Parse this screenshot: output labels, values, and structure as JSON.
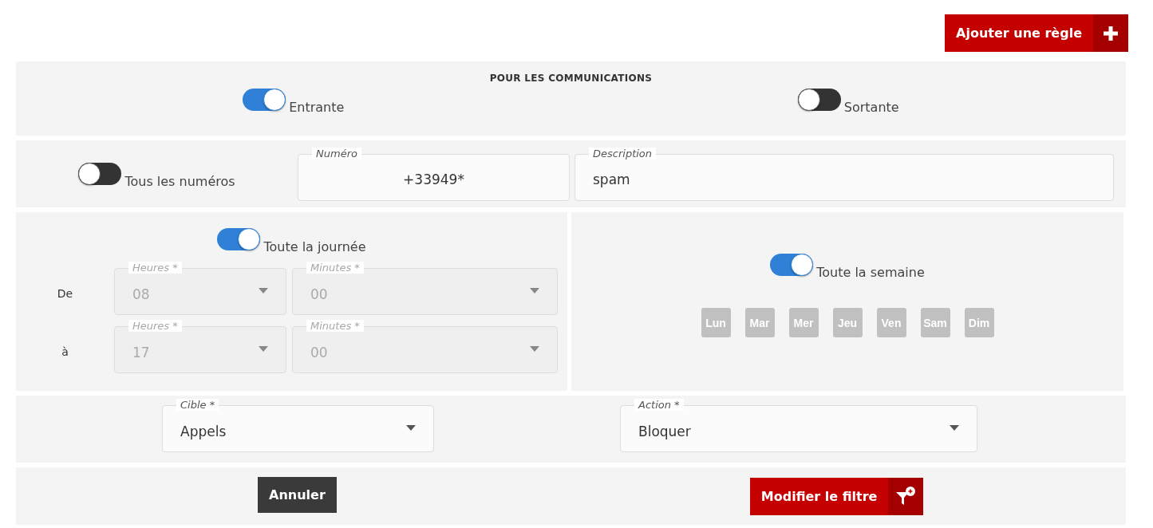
{
  "add_rule_button": {
    "label": "Ajouter une règle"
  },
  "communications": {
    "title": "POUR LES COMMUNICATIONS",
    "toggles": [
      {
        "label": "Entrante",
        "on": true
      },
      {
        "label": "Sortante",
        "on": false
      }
    ]
  },
  "numbers": {
    "all_numbers": {
      "label": "Tous les numéros",
      "on": false
    },
    "number_field": {
      "label": "Numéro",
      "value": "+33949*"
    },
    "description_field": {
      "label": "Description",
      "value": "spam"
    }
  },
  "schedule": {
    "all_day": {
      "label": "Toute la journée",
      "on": true
    },
    "rows": [
      {
        "label": "De",
        "hours": {
          "label": "Heures *",
          "value": "08",
          "disabled": true
        },
        "minutes": {
          "label": "Minutes *",
          "value": "00",
          "disabled": true
        }
      },
      {
        "label": "à",
        "hours": {
          "label": "Heures *",
          "value": "17",
          "disabled": true
        },
        "minutes": {
          "label": "Minutes *",
          "value": "00",
          "disabled": true
        }
      }
    ]
  },
  "week": {
    "all_week": {
      "label": "Toute la semaine",
      "on": true
    },
    "days": [
      {
        "label": "Lun",
        "selected": false
      },
      {
        "label": "Mar",
        "selected": false
      },
      {
        "label": "Mer",
        "selected": false
      },
      {
        "label": "Jeu",
        "selected": false
      },
      {
        "label": "Ven",
        "selected": false
      },
      {
        "label": "Sam",
        "selected": false
      },
      {
        "label": "Dim",
        "selected": false
      }
    ]
  },
  "target": {
    "label": "Cible *",
    "value": "Appels",
    "disabled": false
  },
  "action": {
    "label": "Action *",
    "value": "Bloquer",
    "disabled": false
  },
  "buttons": [
    {
      "label": "Annuler",
      "kind": "cancel"
    },
    {
      "label": "Modifier le filtre",
      "kind": "submit"
    }
  ]
}
